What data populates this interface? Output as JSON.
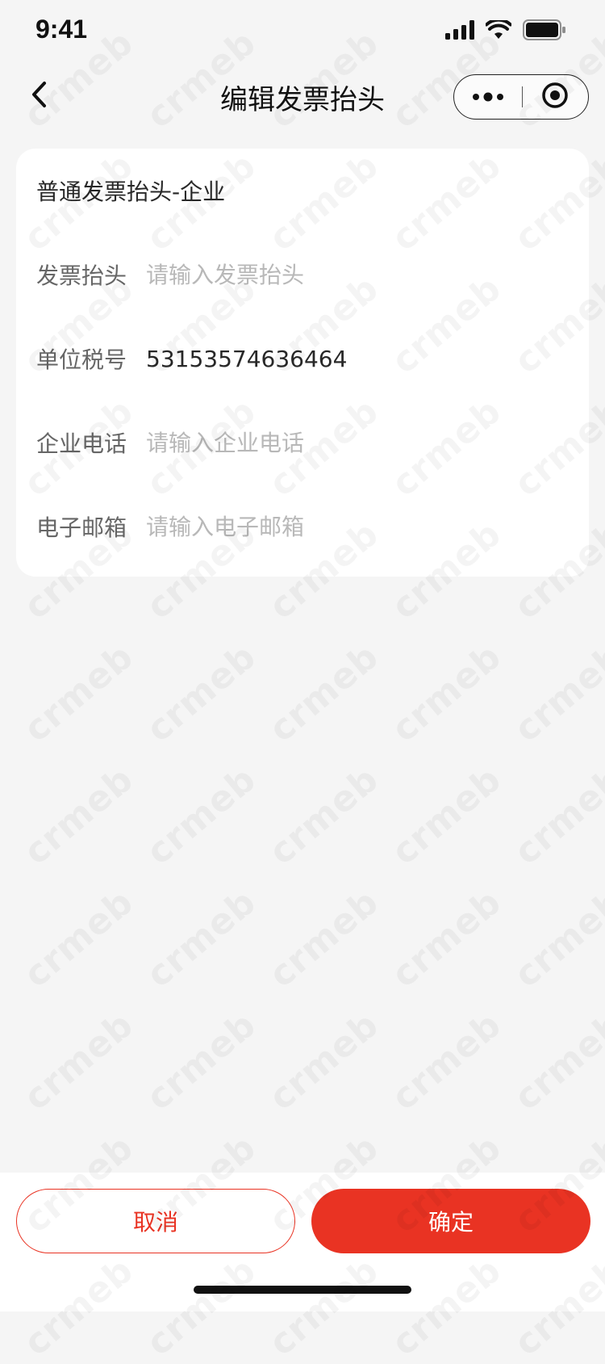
{
  "status_bar": {
    "time": "9:41",
    "icons": [
      "signal-icon",
      "wifi-icon",
      "battery-icon"
    ]
  },
  "nav": {
    "title": "编辑发票抬头",
    "icons": [
      "back-arrow-icon",
      "more-dots-icon",
      "target-close-icon"
    ]
  },
  "form": {
    "header": "普通发票抬头-企业",
    "fields": [
      {
        "label": "发票抬头",
        "value": "",
        "placeholder": "请输入发票抬头"
      },
      {
        "label": "单位税号",
        "value": "53153574636464",
        "placeholder": ""
      },
      {
        "label": "企业电话",
        "value": "",
        "placeholder": "请输入企业电话"
      },
      {
        "label": "电子邮箱",
        "value": "",
        "placeholder": "请输入电子邮箱"
      }
    ]
  },
  "actions": {
    "cancel_label": "取消",
    "confirm_label": "确定"
  },
  "watermark": "crmeb",
  "colors": {
    "accent": "#e93323",
    "background": "#f5f5f5",
    "card": "#ffffff",
    "placeholder": "#b8b8b8",
    "label": "#666666"
  }
}
